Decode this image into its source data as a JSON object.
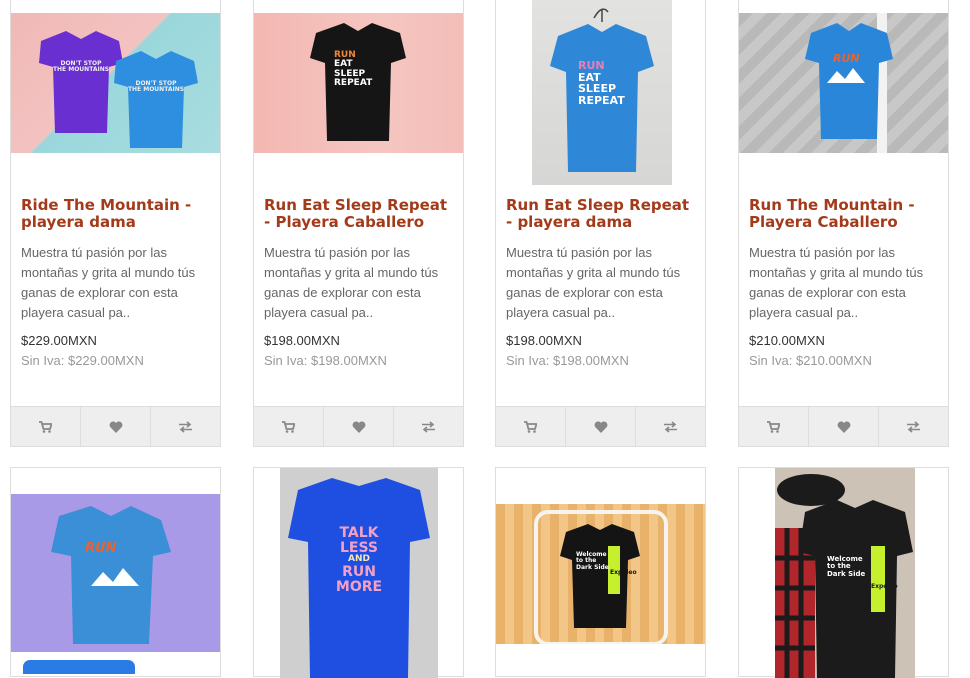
{
  "colors": {
    "title": "#a33a1a",
    "border": "#dddddd",
    "action_bar": "#eeeeee",
    "accent_button": "#2b7be4"
  },
  "icons": {
    "cart": "cart-icon",
    "wishlist": "heart-icon",
    "compare": "compare-arrows-icon"
  },
  "products": [
    {
      "name": "Ride The Mountain - playera dama",
      "description": "Muestra tú pasión por las montañas y grita al mundo tús ganas de explorar con esta playera casual pa..",
      "price": "$229.00MXN",
      "tax": "Sin Iva: $229.00MXN",
      "shirt_text_1": "DON'T STOP",
      "shirt_text_2": "THE MOUNTAINS"
    },
    {
      "name": "Run Eat Sleep Repeat - Playera Caballero",
      "description": "Muestra tú pasión por las montañas y grita al mundo tús ganas de explorar con esta playera casual pa..",
      "price": "$198.00MXN",
      "tax": "Sin Iva: $198.00MXN",
      "shirt_text_1": "RUN",
      "shirt_text_2": "EAT",
      "shirt_text_3": "SLEEP",
      "shirt_text_4": "REPEAT"
    },
    {
      "name": "Run Eat Sleep Repeat - playera dama",
      "description": "Muestra tú pasión por las montañas y grita al mundo tús ganas de explorar con esta playera casual pa..",
      "price": "$198.00MXN",
      "tax": "Sin Iva: $198.00MXN",
      "shirt_text_1": "RUN",
      "shirt_text_2": "EAT",
      "shirt_text_3": "SLEEP",
      "shirt_text_4": "REPEAT"
    },
    {
      "name": "Run The Mountain - Playera Caballero",
      "description": "Muestra tú pasión por las montañas y grita al mundo tús ganas de explorar con esta playera casual pa..",
      "price": "$210.00MXN",
      "tax": "Sin Iva: $210.00MXN",
      "shirt_text_1": "RUN"
    }
  ],
  "products_row2": [
    {
      "shirt_text_1": "RUN"
    },
    {
      "shirt_text_1": "TALK",
      "shirt_text_2": "LESS",
      "shirt_text_3": "AND",
      "shirt_text_4": "RUN",
      "shirt_text_5": "MORE"
    },
    {
      "shirt_text_1": "Welcome to the",
      "shirt_text_2": "Dark Side",
      "shirt_text_3": "Expeleo"
    },
    {
      "shirt_text_1": "Welcome to the",
      "shirt_text_2": "Dark Side",
      "shirt_text_3": "Expeleo"
    }
  ]
}
